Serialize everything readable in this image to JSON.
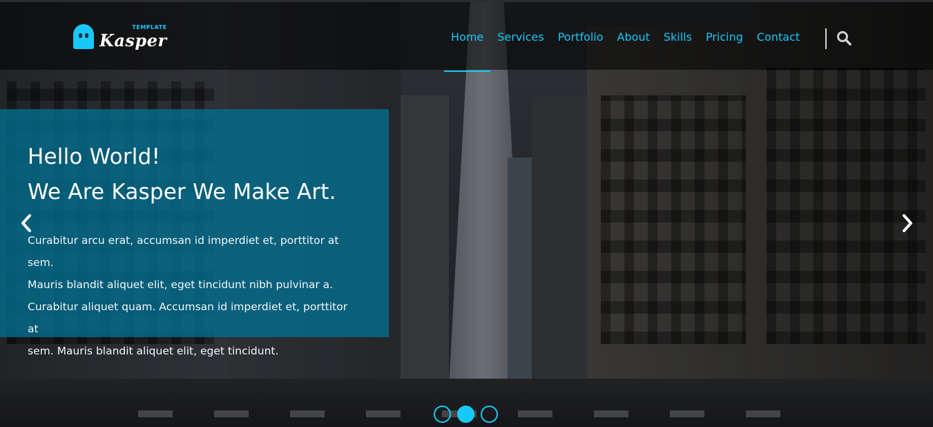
{
  "brand": {
    "name": "Kasper",
    "tag": "TEMPLATE",
    "icon": "ghost-icon",
    "accent": "#19c8fa"
  },
  "nav": {
    "items": [
      {
        "label": "Home",
        "active": true
      },
      {
        "label": "Services",
        "active": false
      },
      {
        "label": "Portfolio",
        "active": false
      },
      {
        "label": "About",
        "active": false
      },
      {
        "label": "Skills",
        "active": false
      },
      {
        "label": "Pricing",
        "active": false
      },
      {
        "label": "Contact",
        "active": false
      }
    ],
    "search_icon": "search-icon"
  },
  "slide": {
    "title_line1": "Hello World!",
    "title_line2": "We Are Kasper We Make Art.",
    "text_line1": "Curabitur arcu erat, accumsan id imperdiet et, porttitor at sem.",
    "text_line2": "Mauris blandit aliquet elit, eget tincidunt nibh pulvinar a.",
    "text_line3": "Curabitur aliquet quam. Accumsan id imperdiet et, porttitor at",
    "text_line4": "sem. Mauris blandit aliquet elit, eget tincidunt.",
    "box_color": "#027091"
  },
  "carousel": {
    "prev_icon": "chevron-left-icon",
    "next_icon": "chevron-right-icon",
    "dots": [
      {
        "active": false
      },
      {
        "active": true
      },
      {
        "active": false
      }
    ]
  }
}
